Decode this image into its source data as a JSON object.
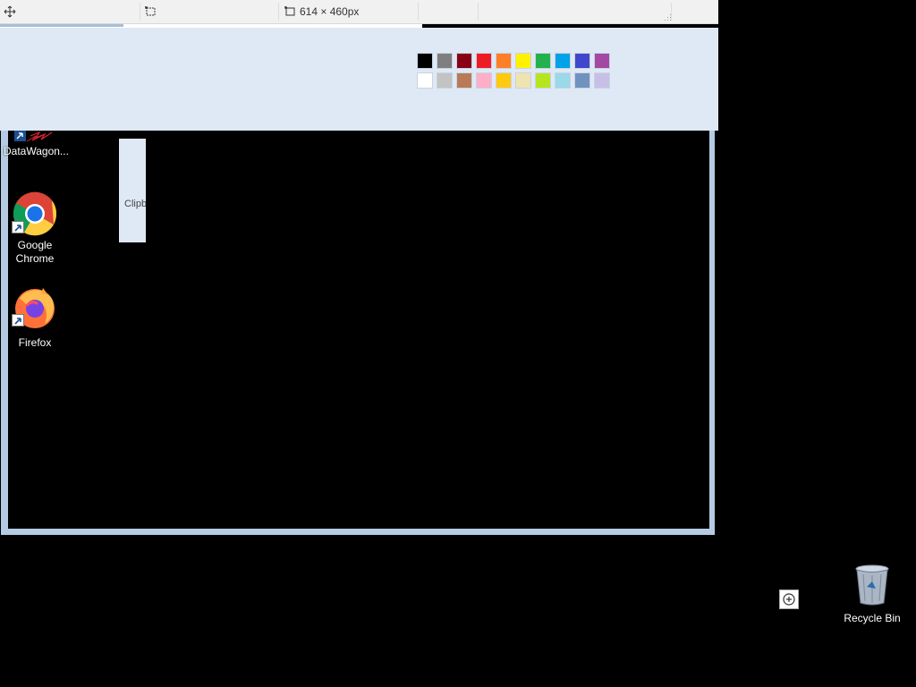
{
  "statusbar": {
    "dimensions_text": "614 × 460px"
  },
  "palette": {
    "row1": [
      "#000000",
      "#7f7f7f",
      "#880015",
      "#ed1c24",
      "#ff7f27",
      "#fff200",
      "#22b14c",
      "#00a2e8",
      "#3f48cc",
      "#a349a4"
    ],
    "row2": [
      "#ffffff",
      "#c3c3c3",
      "#b97a57",
      "#ffaec9",
      "#ffc90e",
      "#efe4b0",
      "#b5e61d",
      "#99d9ea",
      "#7092be",
      "#c8bfe7"
    ]
  },
  "clipboard": {
    "label": "Clipb"
  },
  "desktop": {
    "icons": [
      {
        "label": "DataWagon..."
      },
      {
        "label": "Google\nChrome"
      },
      {
        "label": "Firefox"
      },
      {
        "label": "Recycle Bin"
      }
    ]
  }
}
